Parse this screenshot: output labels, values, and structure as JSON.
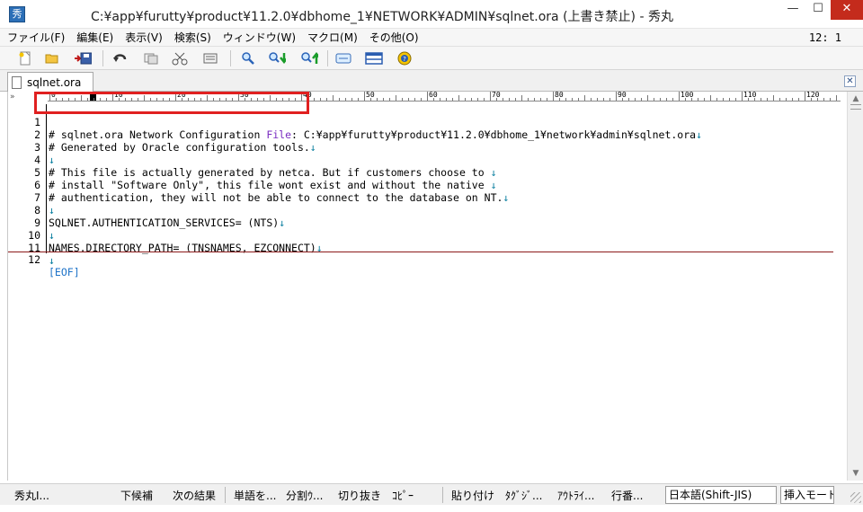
{
  "window": {
    "title": "C:¥app¥furutty¥product¥11.2.0¥dbhome_1¥NETWORK¥ADMIN¥sqlnet.ora (上書き禁止) - 秀丸",
    "app_icon_glyph": "秀",
    "minimize": "—",
    "maximize": "☐",
    "close": "✕"
  },
  "menu": {
    "items": [
      "ファイル(F)",
      "編集(E)",
      "表示(V)",
      "検索(S)",
      "ウィンドウ(W)",
      "マクロ(M)",
      "その他(O)"
    ],
    "cursor_position": "12: 1"
  },
  "toolbar": {
    "buttons": [
      "new-file-icon",
      "open-folder-icon",
      "save-icon",
      "undo-icon",
      "copy-icon",
      "cut-icon",
      "paste-icon",
      "find-icon",
      "find-down-icon",
      "find-up-icon",
      "replace-icon",
      "window-icon",
      "help-icon"
    ]
  },
  "tabs": {
    "active_label": "sqlnet.ora",
    "close_glyph": "✕"
  },
  "editor": {
    "ruler_left": "»",
    "ruler_marks": [
      "0",
      "10",
      "20",
      "30",
      "40",
      "50",
      "60",
      "70",
      "80",
      "90",
      "100",
      "110",
      "120"
    ],
    "lines": [
      {
        "num": "1",
        "text": "# sqlnet.ora Network Configuration ",
        "file_word": "File",
        "rest": ": C:¥app¥furutty¥product¥11.2.0¥dbhome_1¥network¥admin¥sqlnet.ora",
        "nl": "↓"
      },
      {
        "num": "2",
        "text": "# Generated by Oracle configuration tools.",
        "nl": "↓"
      },
      {
        "num": "3",
        "text": "",
        "nl": "↓"
      },
      {
        "num": "4",
        "text": "# This file is actually generated by netca. But if customers choose to ",
        "nl": "↓"
      },
      {
        "num": "5",
        "text": "# install \"Software Only\", this file wont exist and without the native ",
        "nl": "↓"
      },
      {
        "num": "6",
        "text": "# authentication, they will not be able to connect to the database on NT.",
        "nl": "↓"
      },
      {
        "num": "7",
        "text": "",
        "nl": "↓"
      },
      {
        "num": "8",
        "text": "SQLNET.AUTHENTICATION_SERVICES= (NTS)",
        "nl": "↓"
      },
      {
        "num": "9",
        "text": "",
        "nl": "↓"
      },
      {
        "num": "10",
        "text": "NAMES.DIRECTORY_PATH= (TNSNAMES, EZCONNECT)",
        "nl": "↓"
      },
      {
        "num": "11",
        "text": "",
        "nl": "↓"
      },
      {
        "num": "12",
        "text": "",
        "eof": "[EOF]"
      }
    ],
    "highlight_color": "#e02020"
  },
  "statusbar": {
    "items": [
      "秀丸I...",
      "下候補",
      "次の結果",
      "単語を...",
      "分割ｳ...",
      "切り抜き",
      "ｺﾋﾟｰ",
      "貼り付け",
      "ﾀｸﾞｼﾞ...",
      "ｱｳﾄﾗｲ...",
      "行番..."
    ],
    "encoding": "日本語(Shift-JIS)",
    "mode": "挿入モード"
  }
}
